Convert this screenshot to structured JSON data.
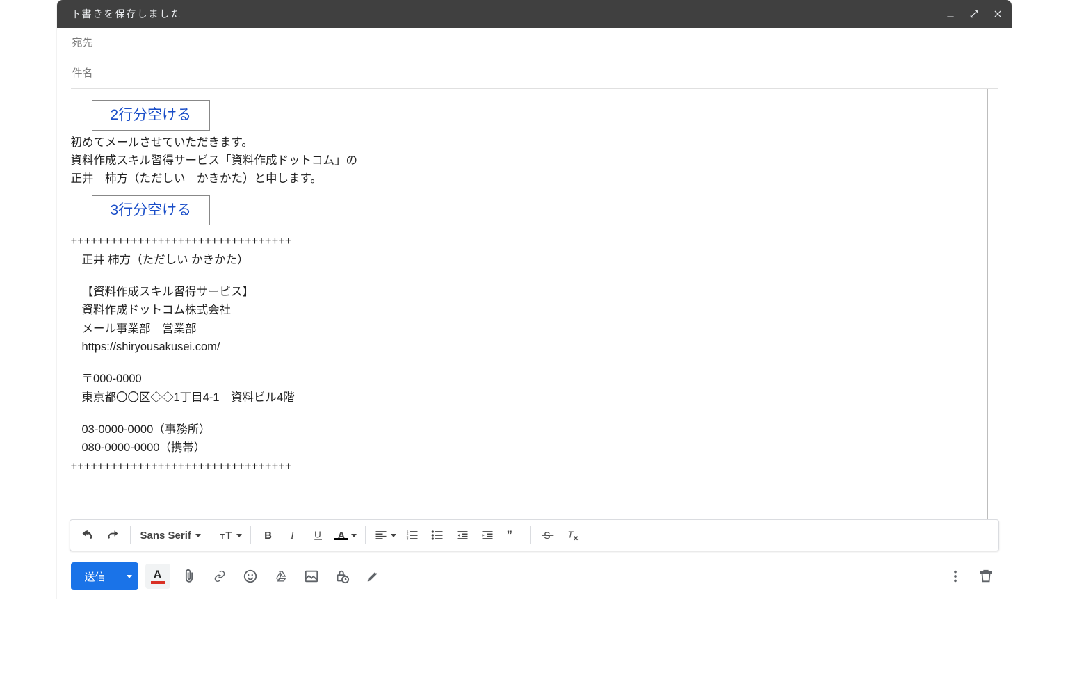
{
  "header": {
    "title": "下書きを保存しました"
  },
  "fields": {
    "to_placeholder": "宛先",
    "to_value": "",
    "subject_placeholder": "件名",
    "subject_value": ""
  },
  "body": {
    "annotation1": "2行分空ける",
    "line1": "初めてメールさせていただきます。",
    "line2": "資料作成スキル習得サービス「資料作成ドットコム」の",
    "line3": "正井　柿方（ただしい　かきかた）と申します。",
    "annotation2": "3行分空ける",
    "divider_top": "+++++++++++++++++++++++++++++++++",
    "sig_name": "正井 柿方（ただしい かきかた）",
    "sig_service": "【資料作成スキル習得サービス】",
    "sig_company": "資料作成ドットコム株式会社",
    "sig_dept": "メール事業部　営業部",
    "sig_url": "https://shiryousakusei.com/",
    "sig_postal": "〒000-0000",
    "sig_address": "東京都〇〇区◇◇1丁目4-1　資料ビル4階",
    "sig_tel_office": "03-0000-0000（事務所）",
    "sig_tel_mobile": "080-0000-0000（携帯）",
    "divider_bottom": "+++++++++++++++++++++++++++++++++"
  },
  "format_toolbar": {
    "font_family": "Sans Serif"
  },
  "bottom": {
    "send_label": "送信"
  }
}
